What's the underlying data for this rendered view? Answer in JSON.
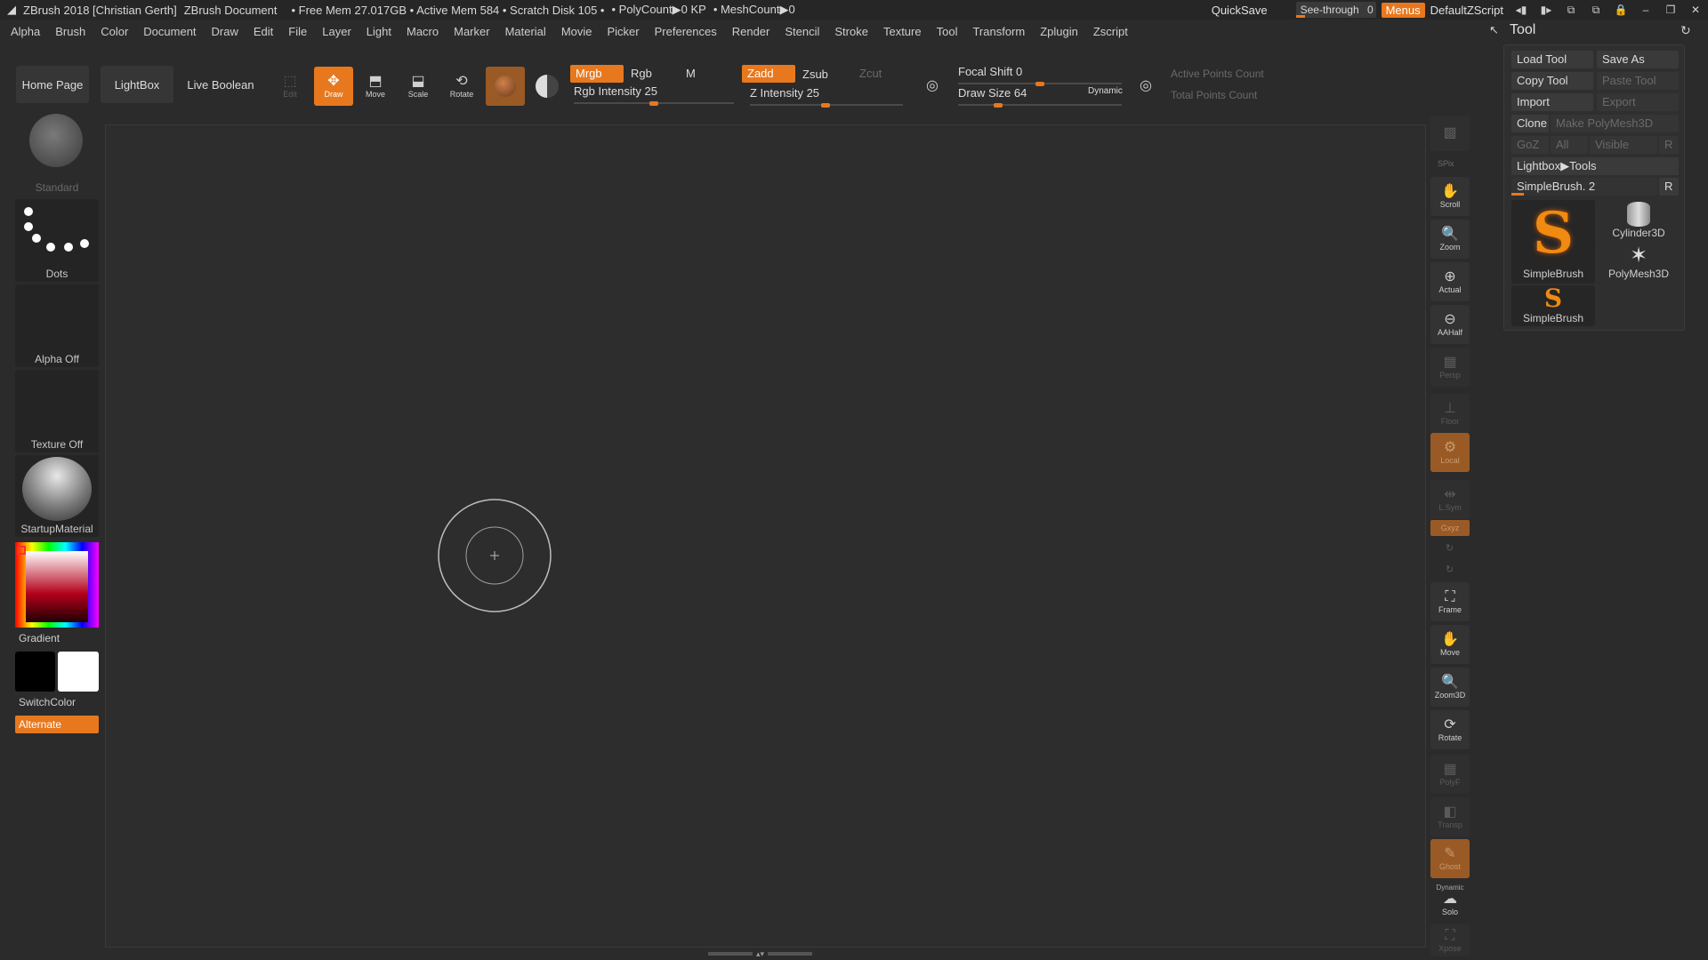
{
  "titlebar": {
    "app": "ZBrush 2018 [Christian Gerth]",
    "doc": "ZBrush Document",
    "stats": "• Free Mem 27.017GB • Active Mem 584 • Scratch Disk 105 •",
    "poly": "• PolyCount▶0 KP",
    "mesh": "• MeshCount▶0",
    "quicksave": "QuickSave",
    "see_through_label": "See-through",
    "see_through_value": "0",
    "menus": "Menus",
    "zscript": "DefaultZScript"
  },
  "menu": [
    "Alpha",
    "Brush",
    "Color",
    "Document",
    "Draw",
    "Edit",
    "File",
    "Layer",
    "Light",
    "Macro",
    "Marker",
    "Material",
    "Movie",
    "Picker",
    "Preferences",
    "Render",
    "Stencil",
    "Stroke",
    "Texture",
    "Tool",
    "Transform",
    "Zplugin",
    "Zscript"
  ],
  "toolbar": {
    "home": "Home Page",
    "lightbox": "LightBox",
    "live_boolean": "Live Boolean",
    "edit": "Edit",
    "draw": "Draw",
    "move": "Move",
    "scale": "Scale",
    "rotate": "Rotate",
    "mrgb": "Mrgb",
    "rgb": "Rgb",
    "m": "M",
    "zadd": "Zadd",
    "zsub": "Zsub",
    "zcut": "Zcut",
    "rgb_intensity": "Rgb Intensity 25",
    "z_intensity": "Z Intensity 25",
    "focal_shift": "Focal Shift 0",
    "draw_size": "Draw Size 64",
    "dynamic": "Dynamic",
    "active_points": "Active Points Count",
    "total_points": "Total Points Count"
  },
  "left": {
    "brush": "Standard",
    "stroke": "Dots",
    "alpha": "Alpha Off",
    "texture": "Texture Off",
    "material": "StartupMaterial",
    "gradient": "Gradient",
    "switchcolor": "SwitchColor",
    "alternate": "Alternate"
  },
  "right": {
    "spix": "SPix",
    "scroll": "Scroll",
    "zoom": "Zoom",
    "actual": "Actual",
    "aahalf": "AAHalf",
    "persp": "Persp",
    "floor": "Floor",
    "local": "Local",
    "lsym": "L.Sym",
    "gxyz": "Gxyz",
    "frame": "Frame",
    "move": "Move",
    "zoom3d": "Zoom3D",
    "rotate": "Rotate",
    "polyf": "PolyF",
    "transp": "Transp",
    "ghost": "Ghost",
    "dynamic": "Dynamic",
    "solo": "Solo",
    "xpose": "Xpose"
  },
  "tool": {
    "title": "Tool",
    "load": "Load Tool",
    "save_as": "Save As",
    "copy": "Copy Tool",
    "paste": "Paste Tool",
    "import": "Import",
    "export": "Export",
    "clone": "Clone",
    "make_poly": "Make PolyMesh3D",
    "goz": "GoZ",
    "all": "All",
    "visible": "Visible",
    "r": "R",
    "lightbox_tools": "Lightbox▶Tools",
    "current": "SimpleBrush. 2",
    "items": [
      "SimpleBrush",
      "Cylinder3D",
      "PolyMesh3D",
      "SimpleBrush"
    ]
  },
  "colors": {
    "accent": "#e8781e"
  }
}
